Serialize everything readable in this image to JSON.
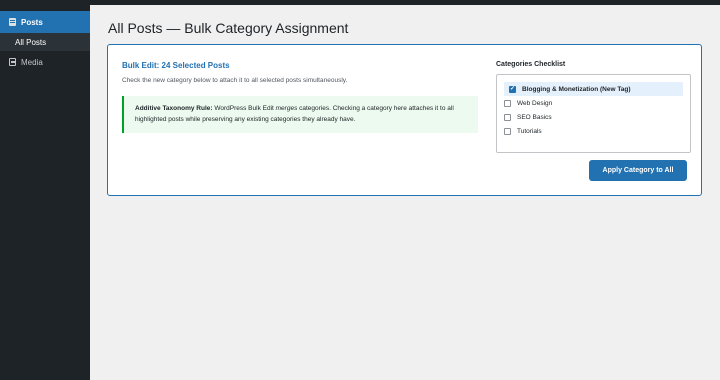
{
  "sidebar": {
    "items": [
      {
        "label": "Posts",
        "icon": "pin-icon",
        "active": true
      },
      {
        "label": "All Posts",
        "submenu": true
      },
      {
        "label": "Media",
        "icon": "media-icon"
      }
    ]
  },
  "page": {
    "title": "All Posts — Bulk Category Assignment"
  },
  "bulk_edit": {
    "title": "Bulk Edit: 24 Selected Posts",
    "description": "Check the new category below to attach it to all selected posts simultaneously."
  },
  "notice": {
    "label": "Additive Taxonomy Rule:",
    "text_before": " WordPress Bulk Edit ",
    "emphasis": "merges",
    "text_after": " categories. Checking a category here attaches it to all highlighted posts while preserving any existing categories they already have."
  },
  "categories": {
    "heading": "Categories Checklist",
    "items": [
      {
        "label": "Blogging & Monetization (New Tag)",
        "checked": true
      },
      {
        "label": "Web Design",
        "checked": false
      },
      {
        "label": "SEO Basics",
        "checked": false
      },
      {
        "label": "Tutorials",
        "checked": false
      }
    ]
  },
  "actions": {
    "apply_label": "Apply Category to All"
  },
  "colors": {
    "accent": "#2271b1",
    "sidebar_bg": "#1d2327",
    "notice_border": "#00a32a",
    "notice_bg": "#edfaef"
  }
}
